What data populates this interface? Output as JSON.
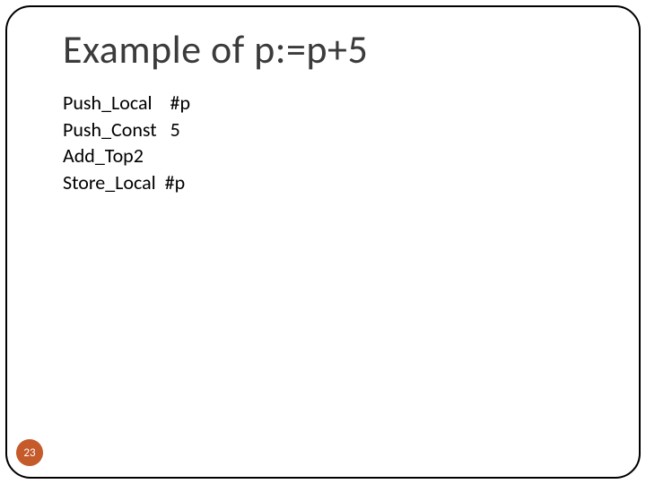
{
  "slide": {
    "title": "Example of p:=p+5",
    "instructions": [
      {
        "op": "Push_Local",
        "arg": "#p"
      },
      {
        "op": "Push_Const",
        "arg": "5"
      },
      {
        "op": "Add_Top2",
        "arg": ""
      },
      {
        "op": "Store_Local",
        "arg": "#p"
      }
    ],
    "page_number": "23"
  }
}
